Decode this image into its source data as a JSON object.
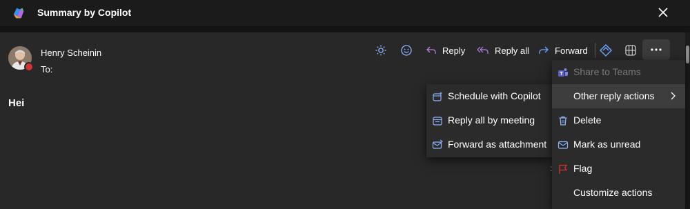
{
  "header": {
    "title": "Summary by Copilot"
  },
  "email": {
    "sender": "Henry Scheinin",
    "to_label": "To:",
    "body": "Hei"
  },
  "toolbar": {
    "reply_label": "Reply",
    "reply_all_label": "Reply all",
    "forward_label": "Forward"
  },
  "submenu": {
    "items": [
      {
        "label": "Schedule with Copilot",
        "icon": "calendar-sparkle-icon"
      },
      {
        "label": "Reply all by meeting",
        "icon": "calendar-reply-icon"
      },
      {
        "label": "Forward as attachment",
        "icon": "mail-forward-icon"
      }
    ]
  },
  "more_menu": {
    "items": [
      {
        "label": "Share to Teams",
        "icon": "teams-icon",
        "disabled": true
      },
      {
        "label": "Other reply actions",
        "icon": "",
        "highlighted": true
      },
      {
        "label": "Delete",
        "icon": "trash-icon"
      },
      {
        "label": "Mark as unread",
        "icon": "envelope-icon"
      },
      {
        "label": "Flag",
        "icon": "flag-icon"
      },
      {
        "label": "Customize actions",
        "icon": ""
      }
    ]
  },
  "colors": {
    "accent_blue": "#4f8ef7",
    "reply_purple": "#b583e0",
    "flag_red": "#d13438",
    "presence_red": "#d13438"
  }
}
